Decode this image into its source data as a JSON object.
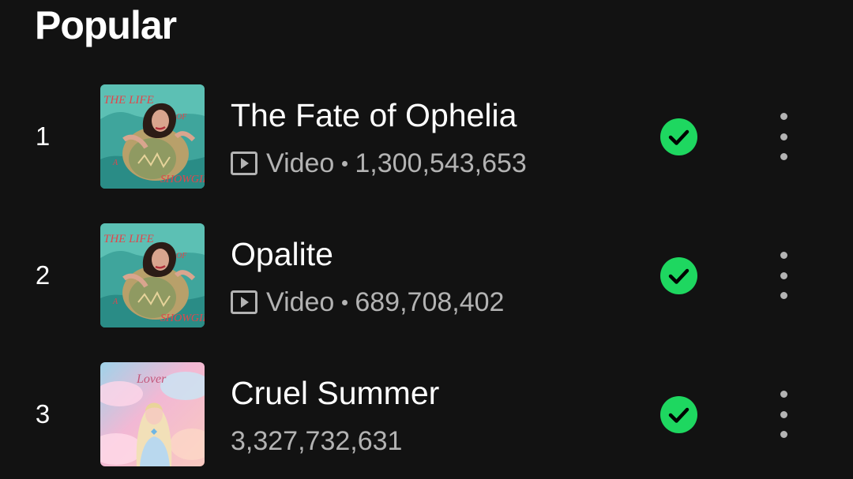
{
  "section": {
    "title": "Popular"
  },
  "tracks": [
    {
      "rank": "1",
      "title": "The Fate of Ophelia",
      "type": "Video",
      "plays": "1,300,543,653",
      "art": "showgirl-album-art",
      "saved": true
    },
    {
      "rank": "2",
      "title": "Opalite",
      "type": "Video",
      "plays": "689,708,402",
      "art": "showgirl-album-art",
      "saved": true
    },
    {
      "rank": "3",
      "title": "Cruel Summer",
      "type": "",
      "plays": "3,327,732,631",
      "art": "lover-album-art",
      "saved": true
    }
  ],
  "art_text": {
    "showgirl": [
      "THE LIFE",
      "OF",
      "A",
      "SHOWGIRL"
    ],
    "lover": "Lover"
  },
  "icons": {
    "video": "video-icon",
    "saved": "check-circle-icon",
    "more": "more-vertical-icon"
  },
  "colors": {
    "background": "#121212",
    "accent": "#1ed760",
    "text_primary": "#ffffff",
    "text_secondary": "#b3b3b3"
  }
}
